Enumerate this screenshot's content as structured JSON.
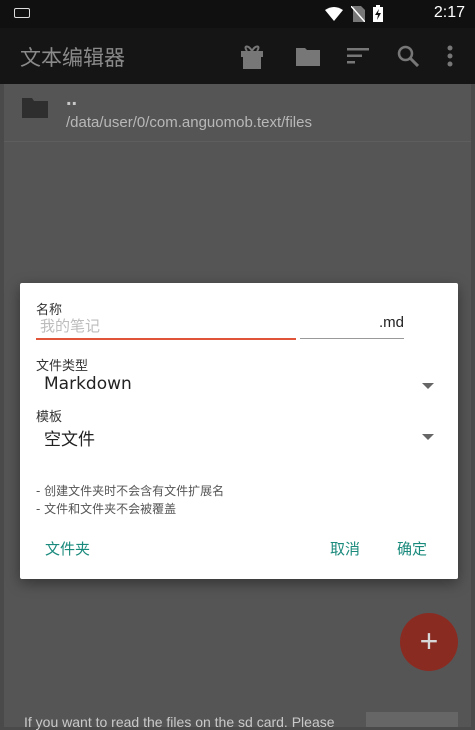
{
  "status_bar": {
    "time": "2:17"
  },
  "app_bar": {
    "title": "文本编辑器",
    "icons": [
      "gift-icon",
      "folder-icon",
      "sort-icon",
      "search-icon",
      "more-vert-icon"
    ]
  },
  "file_list": {
    "items": [
      {
        "name": "..",
        "path": "/data/user/0/com.anguomob.text/files"
      }
    ]
  },
  "dialog": {
    "name_label": "名称",
    "name_placeholder": "我的笔记",
    "extension": ".md",
    "file_type_label": "文件类型",
    "file_type_value": "Markdown",
    "template_label": "模板",
    "template_value": "空文件",
    "notes": [
      "- 创建文件夹时不会含有文件扩展名",
      "- 文件和文件夹不会被覆盖"
    ],
    "folder_button": "文件夹",
    "cancel_button": "取消",
    "ok_button": "确定"
  },
  "fab": {
    "label": "+"
  },
  "snackbar": {
    "text": "If you want to read the files on the sd card. Please"
  }
}
